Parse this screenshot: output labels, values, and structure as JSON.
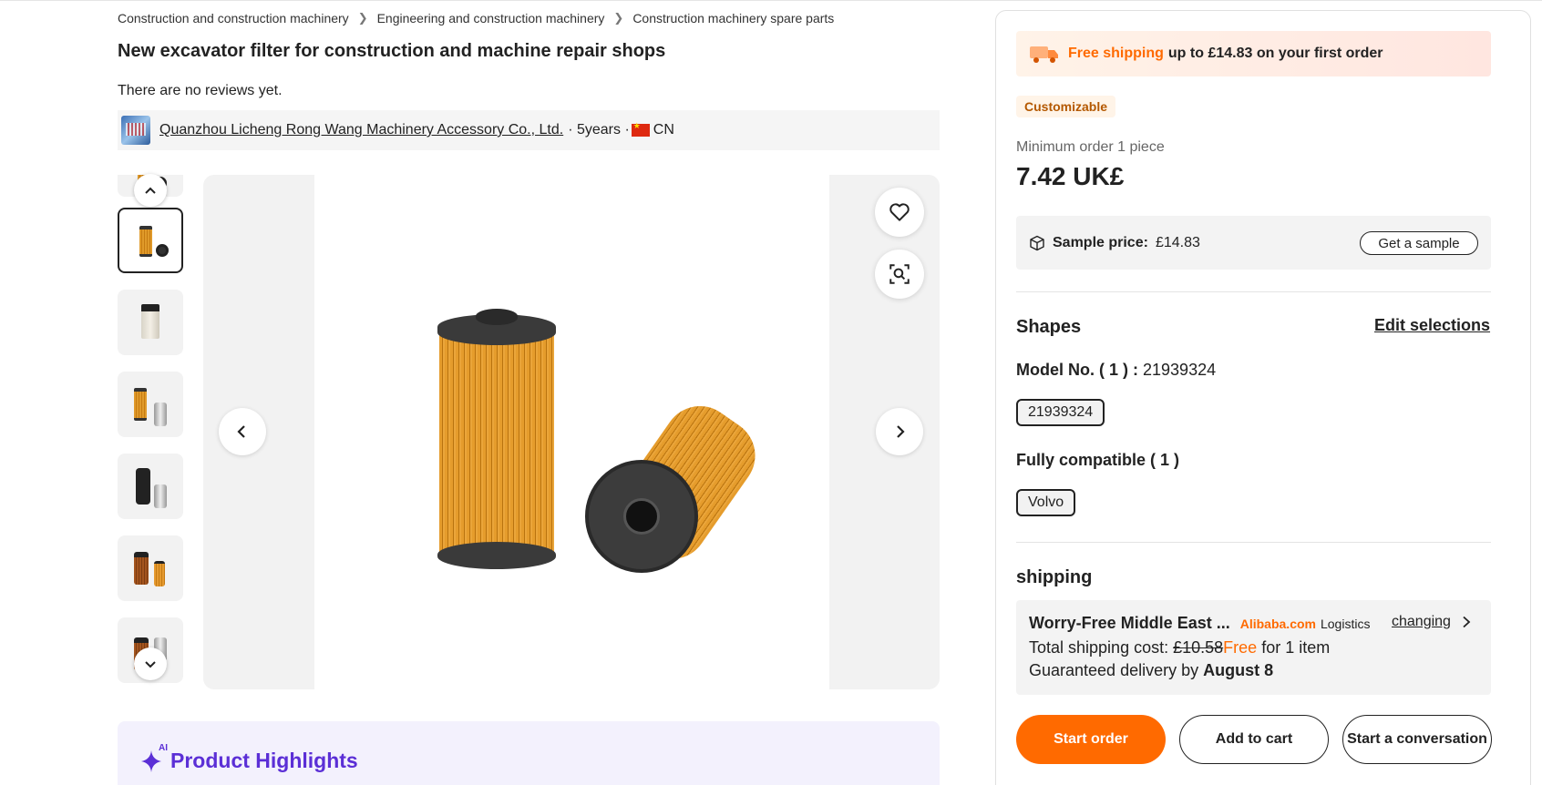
{
  "breadcrumb": [
    "Construction and construction machinery",
    "Engineering and construction machinery",
    "Construction machinery spare parts"
  ],
  "product": {
    "title": "New excavator filter for construction and machine repair shops",
    "reviews": "There are no reviews yet."
  },
  "supplier": {
    "name": "Quanzhou Licheng Rong Wang Machinery Accessory Co., Ltd.",
    "years": "· 5years ·",
    "country": "CN"
  },
  "highlights": {
    "title": "Product Highlights",
    "ai_badge": "AI"
  },
  "panel": {
    "banner_free": "Free shipping",
    "banner_rest": "up to £14.83 on your first order",
    "customizable": "Customizable",
    "min_order": "Minimum order 1 piece",
    "price": "7.42 UK£",
    "sample_label": "Sample price:",
    "sample_price": "£14.83",
    "sample_button": "Get a sample",
    "shapes_title": "Shapes",
    "edit_selections": "Edit selections",
    "model_label": "Model No. ( 1 ) :",
    "model_value": "21939324",
    "model_chip": "21939324",
    "compat_label": "Fully compatible ( 1 )",
    "compat_chip": "Volvo",
    "shipping_title": "shipping",
    "ship_service": "Worry-Free Middle East ...",
    "ship_brand": "Alibaba.com",
    "ship_logistics": "Logistics",
    "ship_change": "changing",
    "ship_cost_label": "Total shipping cost:",
    "ship_cost_old": "£10.58",
    "ship_cost_free": "Free",
    "ship_cost_tail": "for 1 item",
    "ship_delivery_label": "Guaranteed delivery by",
    "ship_delivery_date": "August 8",
    "btn_start_order": "Start order",
    "btn_add_cart": "Add to cart",
    "btn_conversation": "Start a conversation"
  },
  "colors": {
    "accent": "#ff6a00",
    "ai_purple": "#5b2fd6"
  }
}
